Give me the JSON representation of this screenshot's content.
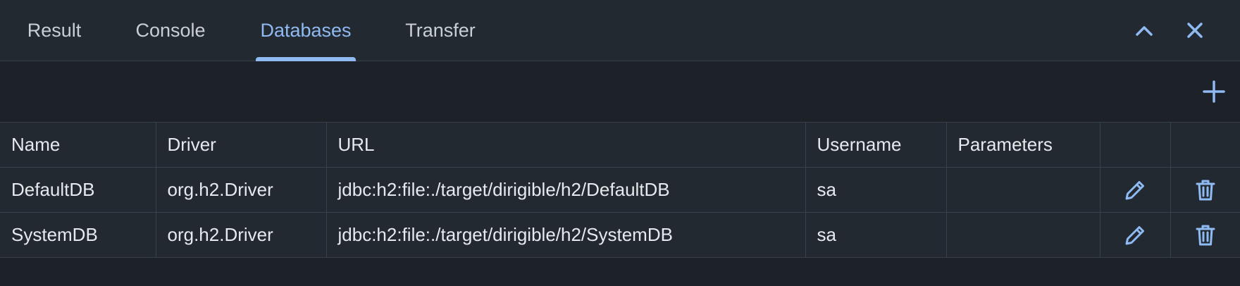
{
  "tabs": [
    {
      "label": "Result",
      "active": false
    },
    {
      "label": "Console",
      "active": false
    },
    {
      "label": "Databases",
      "active": true
    },
    {
      "label": "Transfer",
      "active": false
    }
  ],
  "window_controls": {
    "collapse_icon": "chevron-up-icon",
    "close_icon": "close-icon"
  },
  "toolbar": {
    "add_icon": "plus-icon"
  },
  "table": {
    "columns": [
      "Name",
      "Driver",
      "URL",
      "Username",
      "Parameters",
      "",
      ""
    ],
    "rows": [
      {
        "name": "DefaultDB",
        "driver": "org.h2.Driver",
        "url": "jdbc:h2:file:./target/dirigible/h2/DefaultDB",
        "username": "sa",
        "parameters": "",
        "edit_icon": "pencil-icon",
        "delete_icon": "trash-icon"
      },
      {
        "name": "SystemDB",
        "driver": "org.h2.Driver",
        "url": "jdbc:h2:file:./target/dirigible/h2/SystemDB",
        "username": "sa",
        "parameters": "",
        "edit_icon": "pencil-icon",
        "delete_icon": "trash-icon"
      }
    ]
  },
  "colors": {
    "accent": "#8fbaf2",
    "background": "#1d2228",
    "panel": "#232931",
    "border": "#38404a",
    "text": "#e6e9ed"
  }
}
